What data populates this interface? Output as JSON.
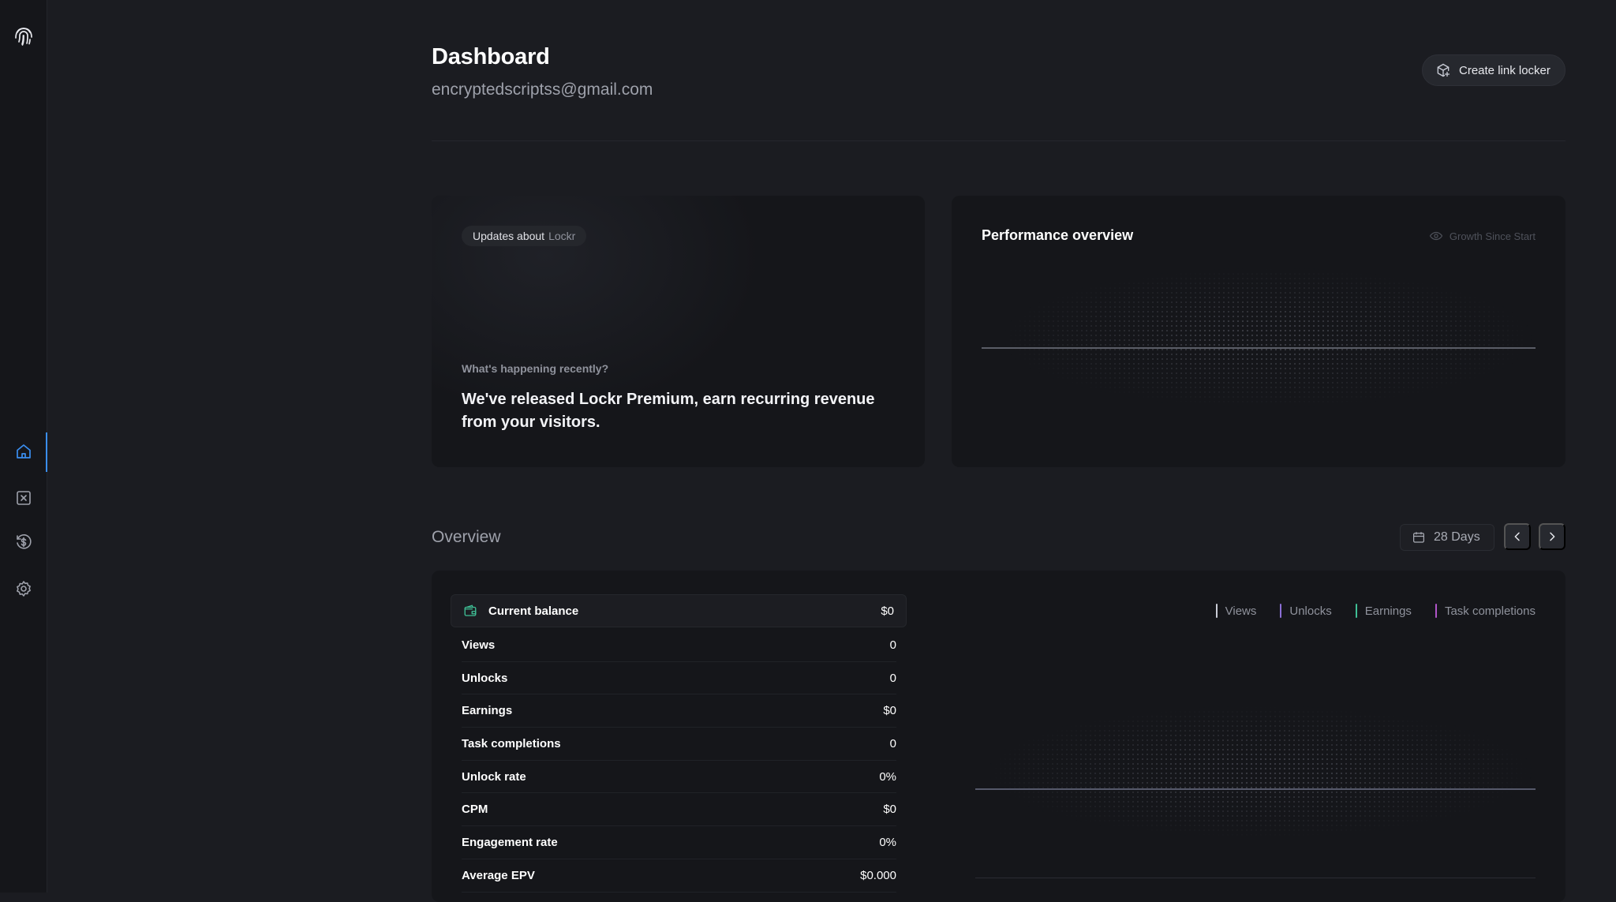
{
  "header": {
    "title": "Dashboard",
    "email": "encryptedscriptss@gmail.com",
    "create_button": "Create link locker"
  },
  "sidebar": {
    "logo_icon": "fingerprint-icon",
    "items": [
      {
        "icon": "home-icon",
        "active": true
      },
      {
        "icon": "link-locker-icon",
        "active": false
      },
      {
        "icon": "billing-icon",
        "active": false
      },
      {
        "icon": "settings-icon",
        "active": false
      }
    ]
  },
  "updates": {
    "pill_prefix": "Updates about",
    "pill_accent": "Lockr",
    "kicker": "What's happening recently?",
    "headline": "We've released Lockr Premium, earn recurring revenue from your visitors."
  },
  "performance": {
    "title": "Performance overview",
    "toggle_label": "Growth Since Start"
  },
  "overview": {
    "title": "Overview",
    "range": "28 Days",
    "balance": {
      "label": "Current balance",
      "value": "$0"
    },
    "stats": [
      {
        "label": "Views",
        "value": "0"
      },
      {
        "label": "Unlocks",
        "value": "0"
      },
      {
        "label": "Earnings",
        "value": "$0"
      },
      {
        "label": "Task completions",
        "value": "0"
      },
      {
        "label": "Unlock rate",
        "value": "0%"
      },
      {
        "label": "CPM",
        "value": "$0"
      },
      {
        "label": "Engagement rate",
        "value": "0%"
      },
      {
        "label": "Average EPV",
        "value": "$0.000"
      }
    ],
    "legend": [
      {
        "label": "Views",
        "color": "#c9ccd6"
      },
      {
        "label": "Unlocks",
        "color": "#8b6fd6"
      },
      {
        "label": "Earnings",
        "color": "#3fbf95"
      },
      {
        "label": "Task completions",
        "color": "#b055c9"
      }
    ]
  },
  "colors": {
    "background": "#1b1c21",
    "card": "#15161a",
    "accent": "#3a8ef0",
    "balance_icon": "#3fbf95"
  }
}
